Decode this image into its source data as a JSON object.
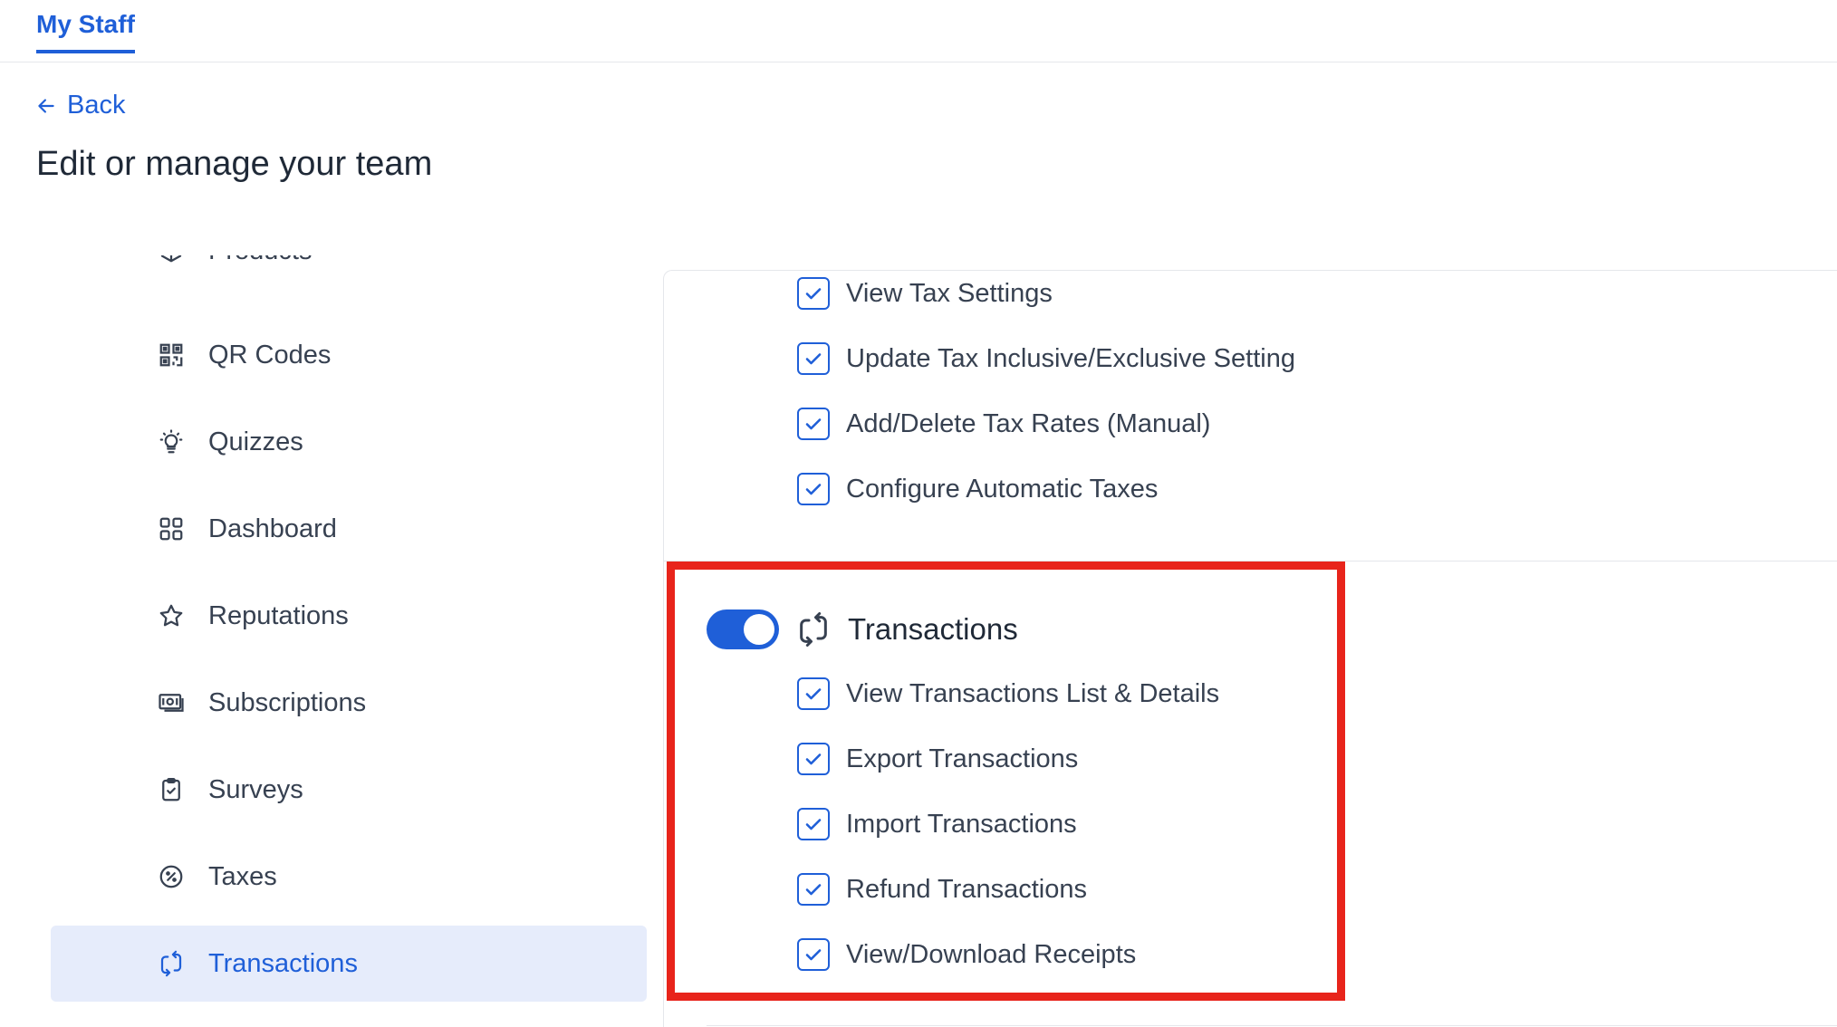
{
  "topnav": {
    "tab_label": "My Staff"
  },
  "back_label": "Back",
  "page_title": "Edit or manage your team",
  "sidebar": {
    "items": [
      {
        "label": "Products",
        "icon": "box-icon"
      },
      {
        "label": "QR Codes",
        "icon": "qr-code-icon"
      },
      {
        "label": "Quizzes",
        "icon": "lightbulb-icon"
      },
      {
        "label": "Dashboard",
        "icon": "grid-icon"
      },
      {
        "label": "Reputations",
        "icon": "star-icon"
      },
      {
        "label": "Subscriptions",
        "icon": "banknote-icon"
      },
      {
        "label": "Surveys",
        "icon": "clipboard-check-icon"
      },
      {
        "label": "Taxes",
        "icon": "percent-circle-icon"
      },
      {
        "label": "Transactions",
        "icon": "repeat-icon",
        "active": true
      }
    ]
  },
  "taxes_permissions": [
    {
      "label": "View Tax Settings",
      "checked": true
    },
    {
      "label": "Update Tax Inclusive/Exclusive Setting",
      "checked": true
    },
    {
      "label": "Add/Delete Tax Rates (Manual)",
      "checked": true
    },
    {
      "label": "Configure Automatic Taxes",
      "checked": true
    }
  ],
  "transactions_section": {
    "title": "Transactions",
    "enabled": true,
    "icon": "repeat-icon",
    "permissions": [
      {
        "label": "View Transactions List & Details",
        "checked": true
      },
      {
        "label": "Export Transactions",
        "checked": true
      },
      {
        "label": "Import Transactions",
        "checked": true
      },
      {
        "label": "Refund Transactions",
        "checked": true
      },
      {
        "label": "View/Download Receipts",
        "checked": true
      }
    ]
  },
  "colors": {
    "accent": "#1f5fd8",
    "highlight": "#e8241b",
    "active_bg": "#e6ecfb"
  }
}
